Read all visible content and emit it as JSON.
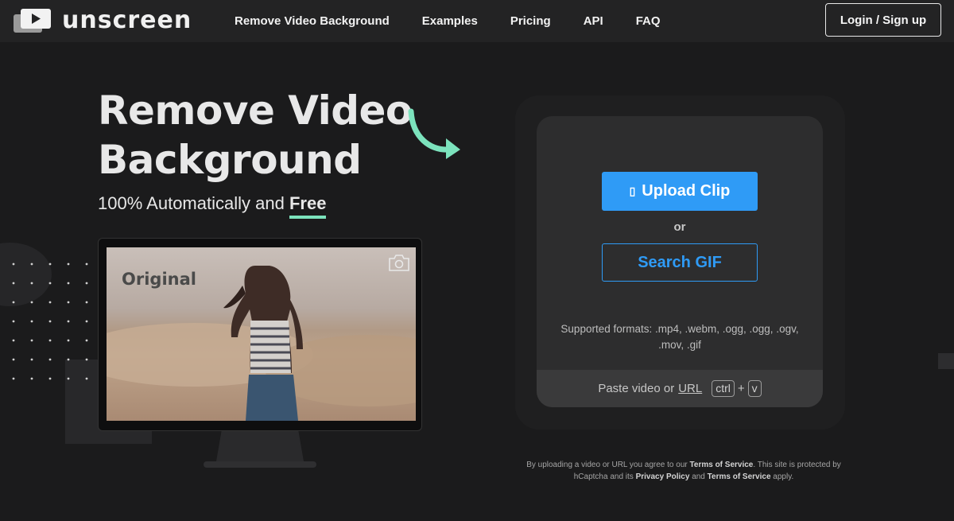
{
  "header": {
    "brand": "unscreen",
    "nav": [
      {
        "label": "Remove Video Background"
      },
      {
        "label": "Examples"
      },
      {
        "label": "Pricing"
      },
      {
        "label": "API"
      },
      {
        "label": "FAQ"
      }
    ],
    "login_label": "Login / Sign up"
  },
  "hero": {
    "title_line1": "Remove Video",
    "title_line2": "Background",
    "subtitle_prefix": "100% Automatically and",
    "subtitle_emphasis": "Free",
    "preview_label": "Original"
  },
  "upload": {
    "upload_label": "Upload Clip",
    "or_label": "or",
    "gif_label": "Search GIF",
    "formats": "Supported formats: .mp4, .webm, .ogg, .ogg, .ogv, .mov, .gif",
    "paste_prefix": "Paste video or",
    "paste_url": "URL",
    "key_ctrl": "ctrl",
    "key_plus": "+",
    "key_v": "v"
  },
  "legal": {
    "t1": "By uploading a video or URL you agree to our",
    "tos": "Terms of Service",
    "t2": ". This site is protected by hCaptcha and its",
    "privacy": "Privacy Policy",
    "t3": "and",
    "tos2": "Terms of Service",
    "t4": "apply."
  },
  "colors": {
    "accent": "#2f9bf6",
    "highlight": "#7ce3bd",
    "background": "#1b1b1c"
  },
  "icons": {
    "logo": "play-window-icon",
    "upload": "upload-icon",
    "camera": "camera-icon",
    "arrow": "curved-arrow-icon"
  }
}
